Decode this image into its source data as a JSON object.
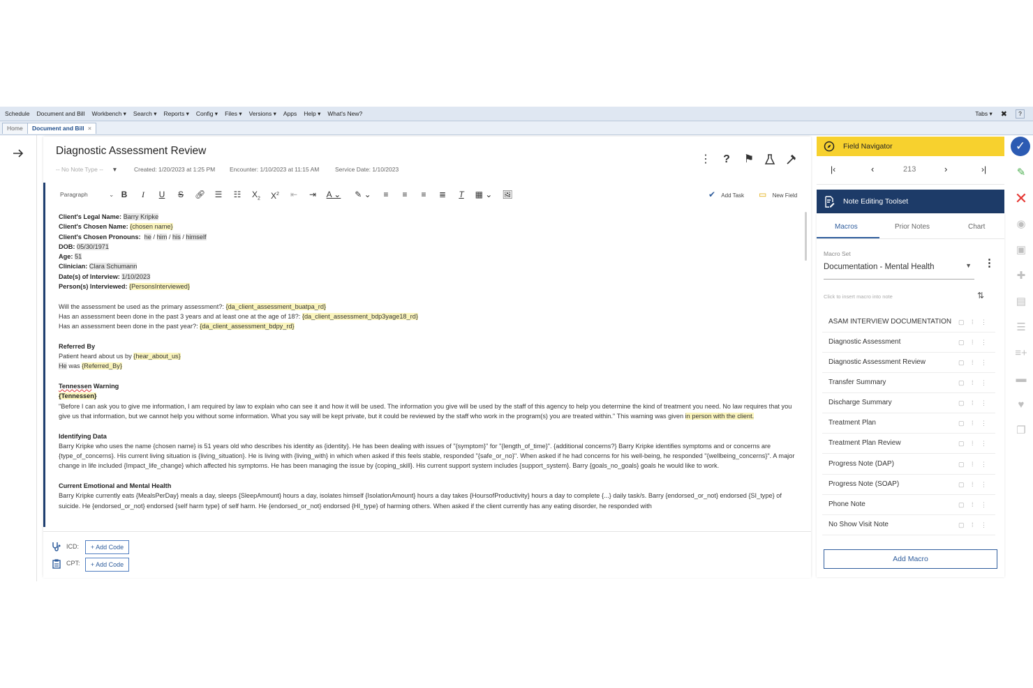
{
  "menu": {
    "items": [
      "Schedule",
      "Document and Bill",
      "Workbench ▾",
      "Search ▾",
      "Reports ▾",
      "Config ▾",
      "Files ▾",
      "Versions ▾",
      "Apps",
      "Help ▾",
      "What's New?"
    ],
    "tabs_label": "Tabs ▾",
    "help": "?"
  },
  "tabs": {
    "home": "Home",
    "active": "Document and Bill",
    "active_close": "×"
  },
  "note": {
    "title": "Diagnostic Assessment Review",
    "note_type": "-- No Note Type --",
    "created": "Created: 1/20/2023 at 1:25 PM",
    "encounter": "Encounter: 1/10/2023 at 11:15 AM",
    "service_date": "Service Date: 1/10/2023"
  },
  "toolbar": {
    "paragraph": "Paragraph",
    "add_task": "Add Task",
    "new_field": "New Field"
  },
  "content": {
    "legal_name_label": "Client's Legal Name:",
    "legal_name": "Barry Kripke",
    "chosen_name_label": "Client's Chosen Name:",
    "chosen_name": "{chosen name}",
    "pronouns_label": "Client's Chosen Pronouns:",
    "p1": "he",
    "p2": "him",
    "p3": "his",
    "p4": "himself",
    "dob_label": "DOB:",
    "dob": "05/30/1971",
    "age_label": "Age:",
    "age": "51",
    "clinician_label": "Clinician:",
    "clinician": "Clara Schumann",
    "date_label": "Date(s) of Interview:",
    "date": "1/10/2023",
    "persons_label": "Person(s) Interviewed:",
    "persons": "{PersonsInterviewed}",
    "q1": "Will the assessment be used as the primary assessment?:",
    "q1v": "{da_client_assessment_buatpa_rd}",
    "q2": "Has an assessment been done in the past 3 years and at least one at the age of 18?:",
    "q2v": "{da_client_assessment_bdp3yage18_rd}",
    "q3": "Has an assessment been done in the past year?:",
    "q3v": "{da_client_assessment_bdpy_rd}",
    "referred_heading": "Referred By",
    "referred_line1": "Patient heard about us by",
    "hear_about": "{hear_about_us}",
    "he": "He",
    "was": "was",
    "referred_by": "{Referred_By}",
    "tn_heading_a": "Tennessen",
    "tn_heading_b": "Warning",
    "tn_field": "{Tennessen}",
    "tn_text": "\"Before I can ask you to give me information, I am required by law to explain who can see it and how it will be used. The information you give will be used by the staff of this agency to help you determine the kind of treatment you need. No law requires that you give us that information, but we cannot help you without some information. What you say will be kept private, but it could be reviewed by the staff who work in the program(s) you are treated within.\" This warning was given",
    "tn_tail": "in person with the client.",
    "id_heading": "Identifying Data",
    "id_text": " Barry Kripke who uses the name {chosen name} is 51 years old who describes his identity as {identity}. He has been dealing with issues of \"{symptom}\" for \"{length_of_time}\". {additional concerns?} Barry Kripke identifies symptoms and or concerns are {type_of_concerns}. His current living situation is {living_situation}. He is living with {living_with} in which when asked if this feels stable, responded \"{safe_or_no}\". When asked if he had concerns for his well-being, he responded \"{wellbeing_concerns}\". A major change in life included {Impact_life_change} which affected his symptoms. He has been managing the issue by {coping_skill}. His current support system includes {support_system}. Barry {goals_no_goals} goals he would like to work.",
    "emo_heading": "Current Emotional and Mental Health",
    "emo_text": "Barry Kripke currently eats {MealsPerDay} meals a day, sleeps {SleepAmount} hours a day, isolates himself {IsolationAmount} hours a day takes {HoursofProductivity} hours a day to complete {...} daily task/s. Barry {endorsed_or_not} endorsed {SI_type} of suicide. He {endorsed_or_not} endorsed {self harm type} of self harm. He {endorsed_or_not} endorsed {HI_type} of harming others. When asked if the client currently has any eating disorder, he responded with"
  },
  "codes": {
    "icd_label": "ICD:",
    "cpt_label": "CPT:",
    "add_code": "+ Add Code"
  },
  "field_navigator": {
    "title": "Field Navigator",
    "count": "213"
  },
  "toolset": {
    "title": "Note Editing Toolset",
    "tabs": [
      "Macros",
      "Prior Notes",
      "Chart"
    ],
    "macro_set_label": "Macro Set",
    "macro_set_value": "Documentation - Mental Health",
    "hint": "Click to insert macro into note",
    "macros": [
      "ASAM INTERVIEW DOCUMENTATION",
      "Diagnostic Assessment",
      "Diagnostic Assessment Review",
      "Transfer Summary",
      "Discharge Summary",
      "Treatment Plan",
      "Treatment Plan Review",
      "Progress Note (DAP)",
      "Progress Note (SOAP)",
      "Phone Note",
      "No Show Visit Note"
    ],
    "add_macro": "Add Macro"
  },
  "colors": {
    "accent": "#1f3f70",
    "navigator": "#f7d12e",
    "field_highlight": "#fbf5bd",
    "link": "#2e5c9c"
  }
}
